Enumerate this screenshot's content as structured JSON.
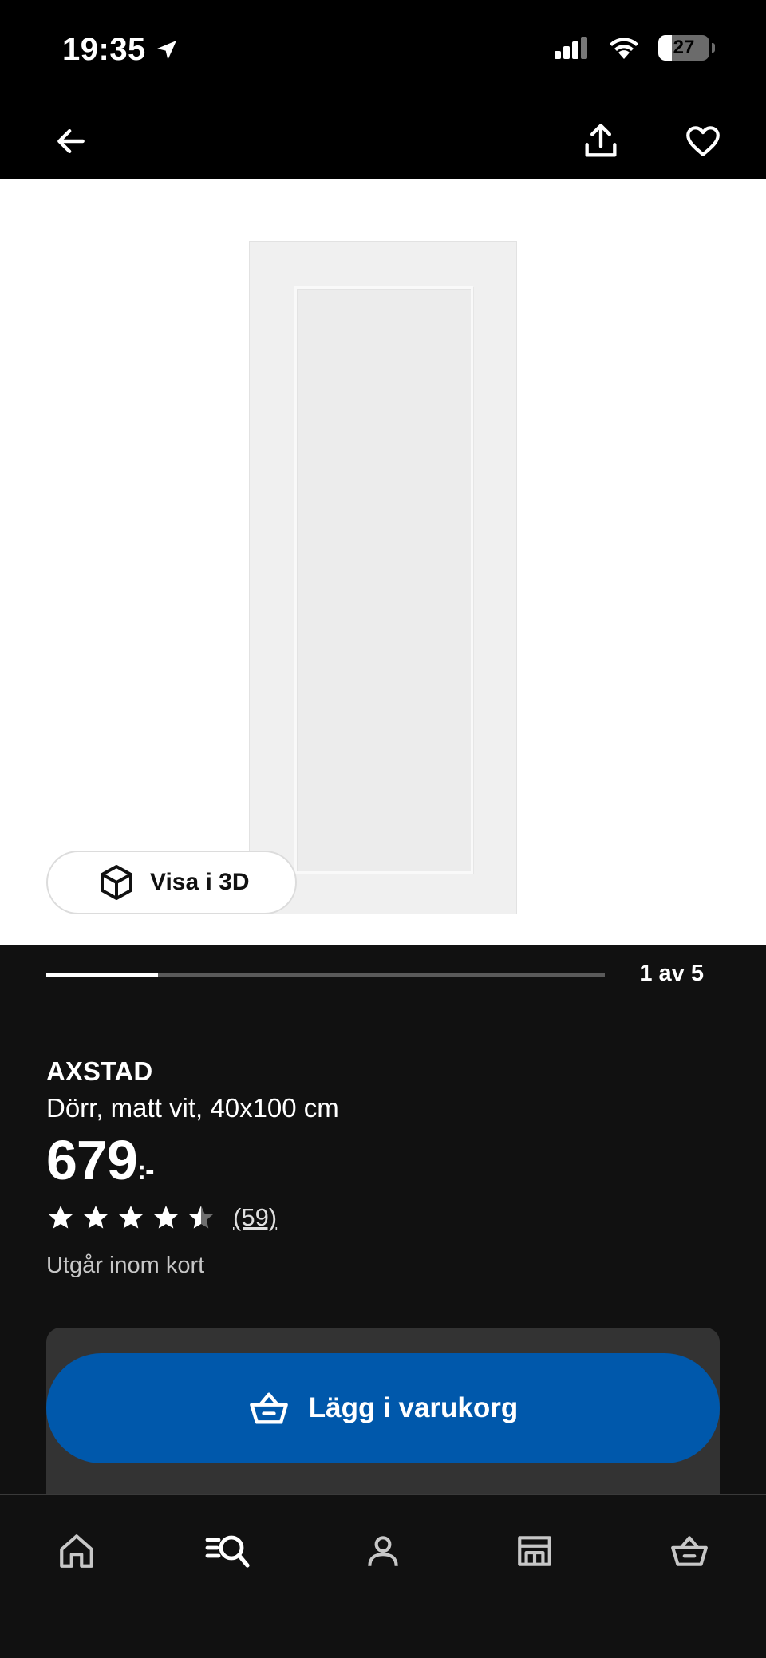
{
  "status_bar": {
    "time": "19:35",
    "battery": "27",
    "battery_level": 0.27,
    "icons": [
      "location-arrow-icon",
      "cellular-signal-icon",
      "wifi-icon",
      "battery-icon"
    ]
  },
  "top_nav": {
    "icons": [
      "back-arrow-icon",
      "share-icon",
      "heart-icon"
    ]
  },
  "gallery": {
    "view_3d_label": "Visa i 3D",
    "page_indicator": "1 av 5",
    "current_page": 1,
    "total_pages": 5,
    "progress": 0.2
  },
  "product": {
    "brand": "AXSTAD",
    "description": "Dörr, matt vit, 40x100 cm",
    "price": "679",
    "price_suffix": ":-",
    "rating": 4.5,
    "rating_max": 5,
    "review_count": "(59)",
    "availability": "Utgår inom kort"
  },
  "cart": {
    "button_label": "Lägg i varukorg",
    "color": "#0058ab"
  },
  "bottom_nav": {
    "tabs": [
      "home-icon",
      "search-icon",
      "profile-icon",
      "store-icon",
      "cart-icon"
    ],
    "active": "search-icon"
  }
}
